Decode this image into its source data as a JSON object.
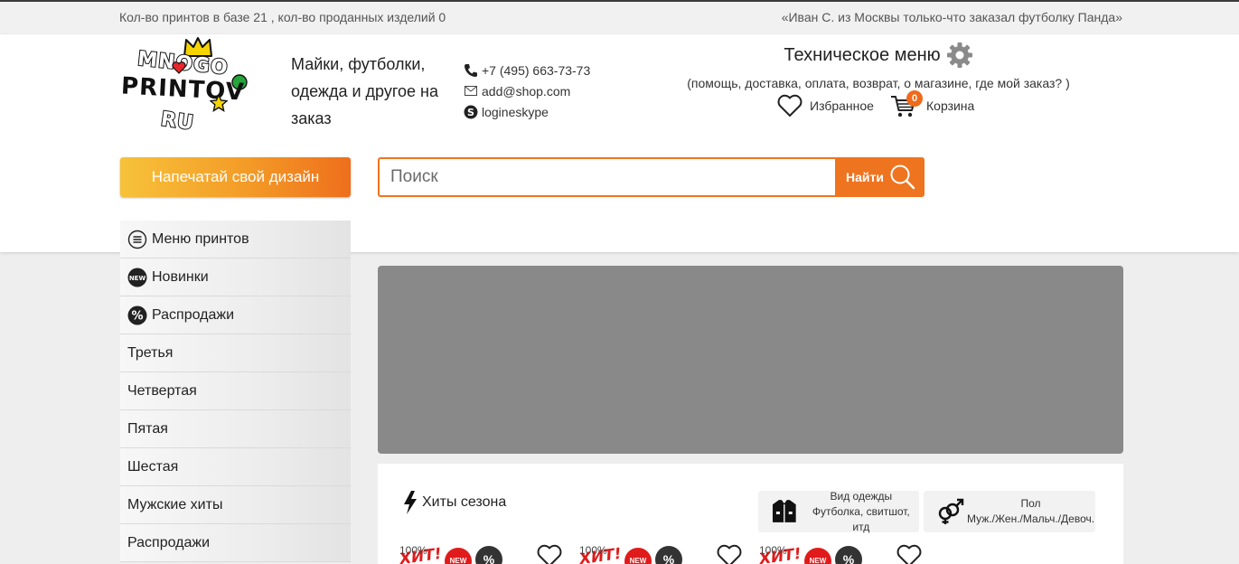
{
  "topbar": {
    "stats": "Кол-во принтов в базе 21 , кол-во проданных изделий 0",
    "notice": "«Иван С. из Москвы только-что заказал футболку Панда»"
  },
  "logo": {
    "line1": "MNOGO",
    "line2": "PRINTOV",
    "line3": "RU"
  },
  "tagline": "Майки, футболки, одежда и другое на заказ",
  "contacts": {
    "phone": "+7 (495) 663-73-73",
    "email": "add@shop.com",
    "skype": "logineskype"
  },
  "techmenu": {
    "title": "Техническое меню",
    "subtitle": "(помощь, доставка, оплата, возврат, о магазине, где мой заказ? )"
  },
  "favorites_label": "Избранное",
  "cart": {
    "label": "Корзина",
    "count": "0"
  },
  "design_button": "Напечатай свой дизайн",
  "search": {
    "placeholder": "Поиск",
    "button": "Найти"
  },
  "sidemenu": [
    {
      "label": "Меню принтов",
      "icon": "menu-icon"
    },
    {
      "label": "Новинки",
      "icon": "new-icon"
    },
    {
      "label": "Распродажи",
      "icon": "percent-icon"
    },
    {
      "label": "Третья"
    },
    {
      "label": "Четвертая"
    },
    {
      "label": "Пятая"
    },
    {
      "label": "Шестая"
    },
    {
      "label": "Мужские хиты"
    },
    {
      "label": "Распродажи"
    }
  ],
  "hits": {
    "title": "Хиты сезона",
    "filter_clothes": {
      "title": "Вид одежды",
      "value": "Футболка, свитшот, итд"
    },
    "filter_gender": {
      "title": "Пол",
      "value": "Муж./Жен./Мальч./Девоч."
    }
  },
  "product_cards": [
    {
      "broken_alt": "100%",
      "hit_label": "ХИТ!",
      "new_label": "NEW",
      "sale_label": "%"
    },
    {
      "broken_alt": "100%",
      "hit_label": "ХИТ!",
      "new_label": "NEW",
      "sale_label": "%"
    },
    {
      "broken_alt": "100%",
      "hit_label": "ХИТ!",
      "new_label": "NEW",
      "sale_label": "%"
    }
  ],
  "colors": {
    "accent": "#ee7420",
    "banner": "#898989",
    "badge": "#ef6a1b"
  }
}
